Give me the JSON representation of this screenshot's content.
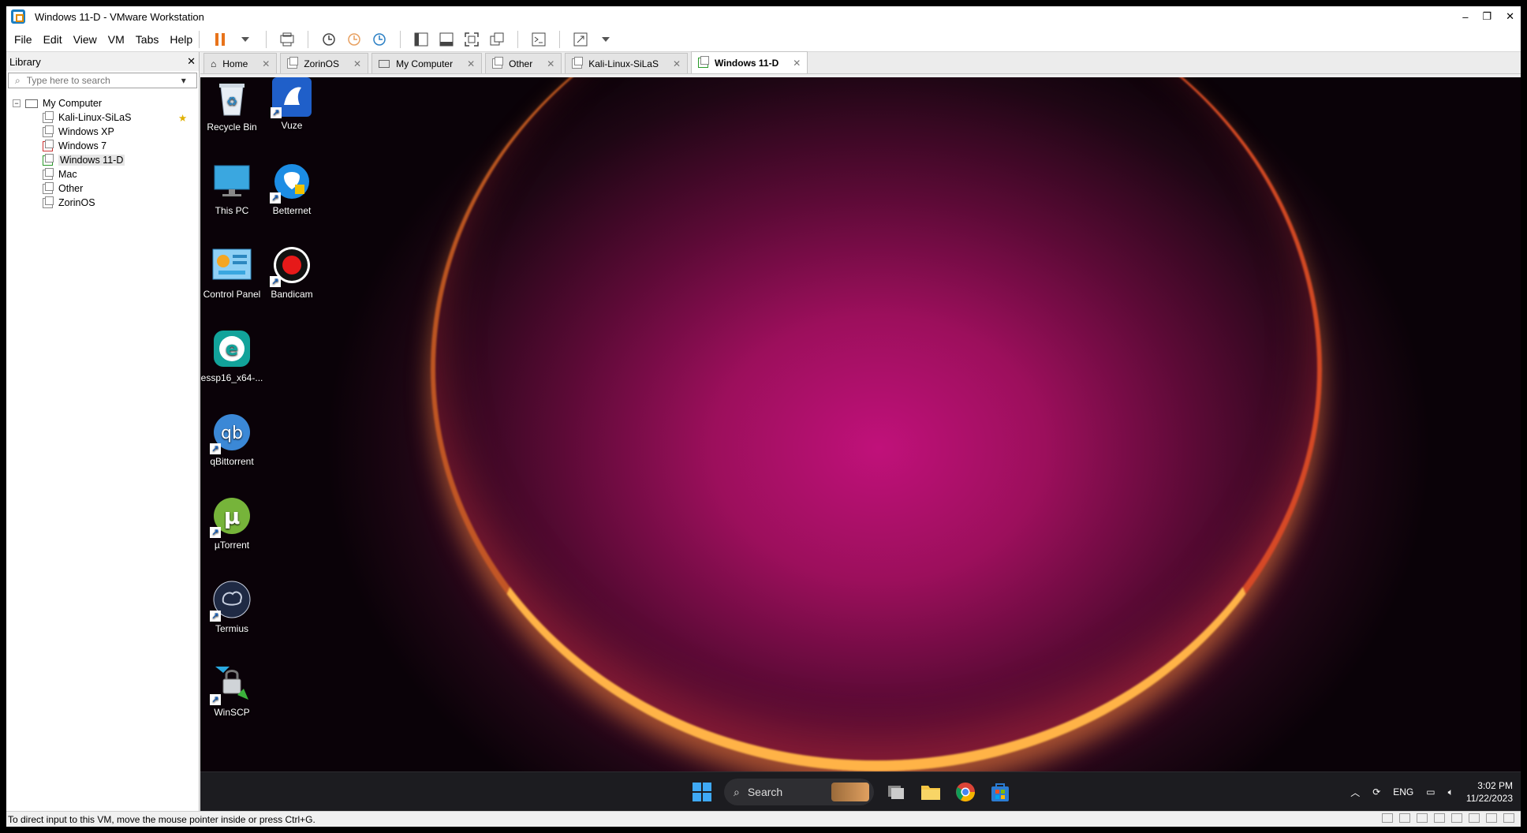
{
  "window": {
    "title": "Windows 11-D - VMware Workstation",
    "minimize": "–",
    "maximize": "❐",
    "close": "✕"
  },
  "menubar": {
    "items": [
      "File",
      "Edit",
      "View",
      "VM",
      "Tabs",
      "Help"
    ]
  },
  "library": {
    "title": "Library",
    "close": "✕",
    "search_placeholder": "Type here to search",
    "root": "My Computer",
    "items": [
      "Kali-Linux-SiLaS",
      "Windows XP",
      "Windows 7",
      "Windows 11-D",
      "Mac",
      "Other",
      "ZorinOS"
    ]
  },
  "tabs": [
    {
      "label": "Home",
      "close": "✕"
    },
    {
      "label": "ZorinOS",
      "close": "✕"
    },
    {
      "label": "My Computer",
      "close": "✕"
    },
    {
      "label": "Other",
      "close": "✕"
    },
    {
      "label": "Kali-Linux-SiLaS",
      "close": "✕"
    },
    {
      "label": "Windows 11-D",
      "close": "✕"
    }
  ],
  "desktop": {
    "icons": [
      "Recycle Bin",
      "Vuze",
      "This PC",
      "Betternet",
      "Control Panel",
      "Bandicam",
      "essp16_x64-...",
      "qBittorrent",
      "µTorrent",
      "Termius",
      "WinSCP"
    ]
  },
  "taskbar": {
    "search": "Search",
    "tray_lang": "ENG",
    "time": "3:02 PM",
    "date": "11/22/2023"
  },
  "status": {
    "text": "To direct input to this VM, move the mouse pointer inside or press Ctrl+G."
  },
  "colors": {
    "accent": "#1b7fc4",
    "pause": "#e8731a"
  }
}
